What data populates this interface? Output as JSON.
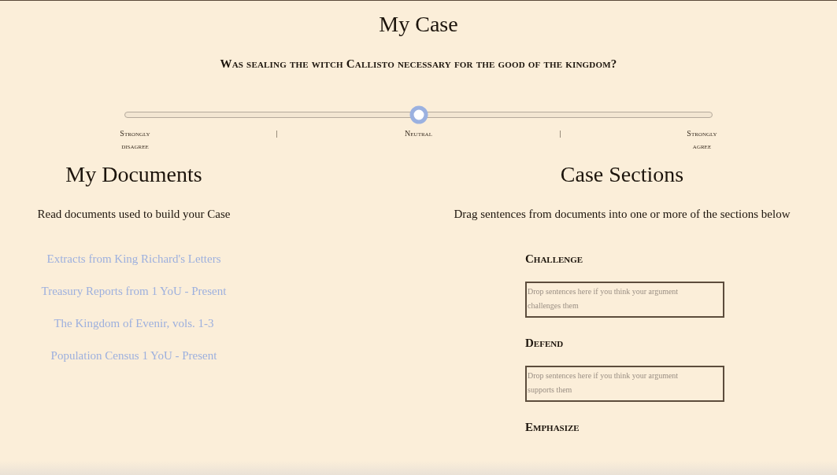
{
  "title": "My Case",
  "question": "Was sealing the witch Callisto necessary for the good of the kingdom?",
  "slider": {
    "level": 0.5,
    "labels": [
      "Strongly disagree",
      "|",
      "Neutral",
      "|",
      "Strongly agree"
    ]
  },
  "documents": {
    "heading": "My Documents",
    "subtitle": "Read documents used to build your Case",
    "links": [
      "Extracts from King Richard's Letters",
      "Treasury Reports from 1 YoU - Present",
      "The Kingdom of Evenir, vols. 1-3",
      "Population Census 1 YoU - Present"
    ]
  },
  "case_sections": {
    "heading": "Case Sections",
    "subtitle": "Drag sentences from documents into one or more of the sections below",
    "sections": [
      {
        "label": "Challenge",
        "placeholder": "Drop sentences here if you think your argument challenges them"
      },
      {
        "label": "Defend",
        "placeholder": "Drop sentences here if you think your argument supports them"
      },
      {
        "label": "Emphasize"
      }
    ]
  }
}
